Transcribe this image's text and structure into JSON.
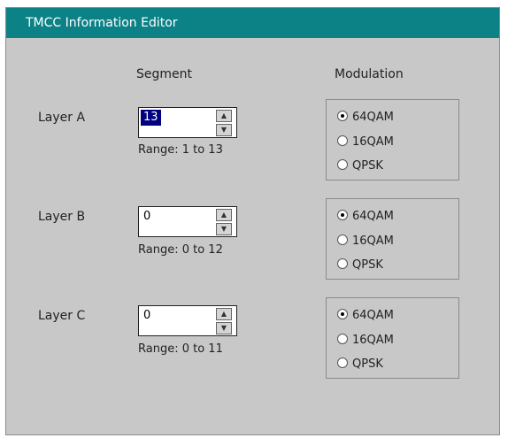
{
  "window": {
    "title": "TMCC Information Editor"
  },
  "columns": {
    "segment": "Segment",
    "modulation": "Modulation"
  },
  "layers": [
    {
      "label": "Layer A",
      "segment_value": "13",
      "range": "Range: 1 to 13",
      "options": [
        "64QAM",
        "16QAM",
        "QPSK"
      ],
      "selected": "64QAM"
    },
    {
      "label": "Layer B",
      "segment_value": "0",
      "range": "Range: 0 to 12",
      "options": [
        "64QAM",
        "16QAM",
        "QPSK"
      ],
      "selected": "64QAM"
    },
    {
      "label": "Layer C",
      "segment_value": "0",
      "range": "Range: 0 to 11",
      "options": [
        "64QAM",
        "16QAM",
        "QPSK"
      ],
      "selected": "64QAM"
    }
  ],
  "colors": {
    "titlebar": "#0c8287",
    "background": "#c8c8c8",
    "selection": "#000080"
  }
}
